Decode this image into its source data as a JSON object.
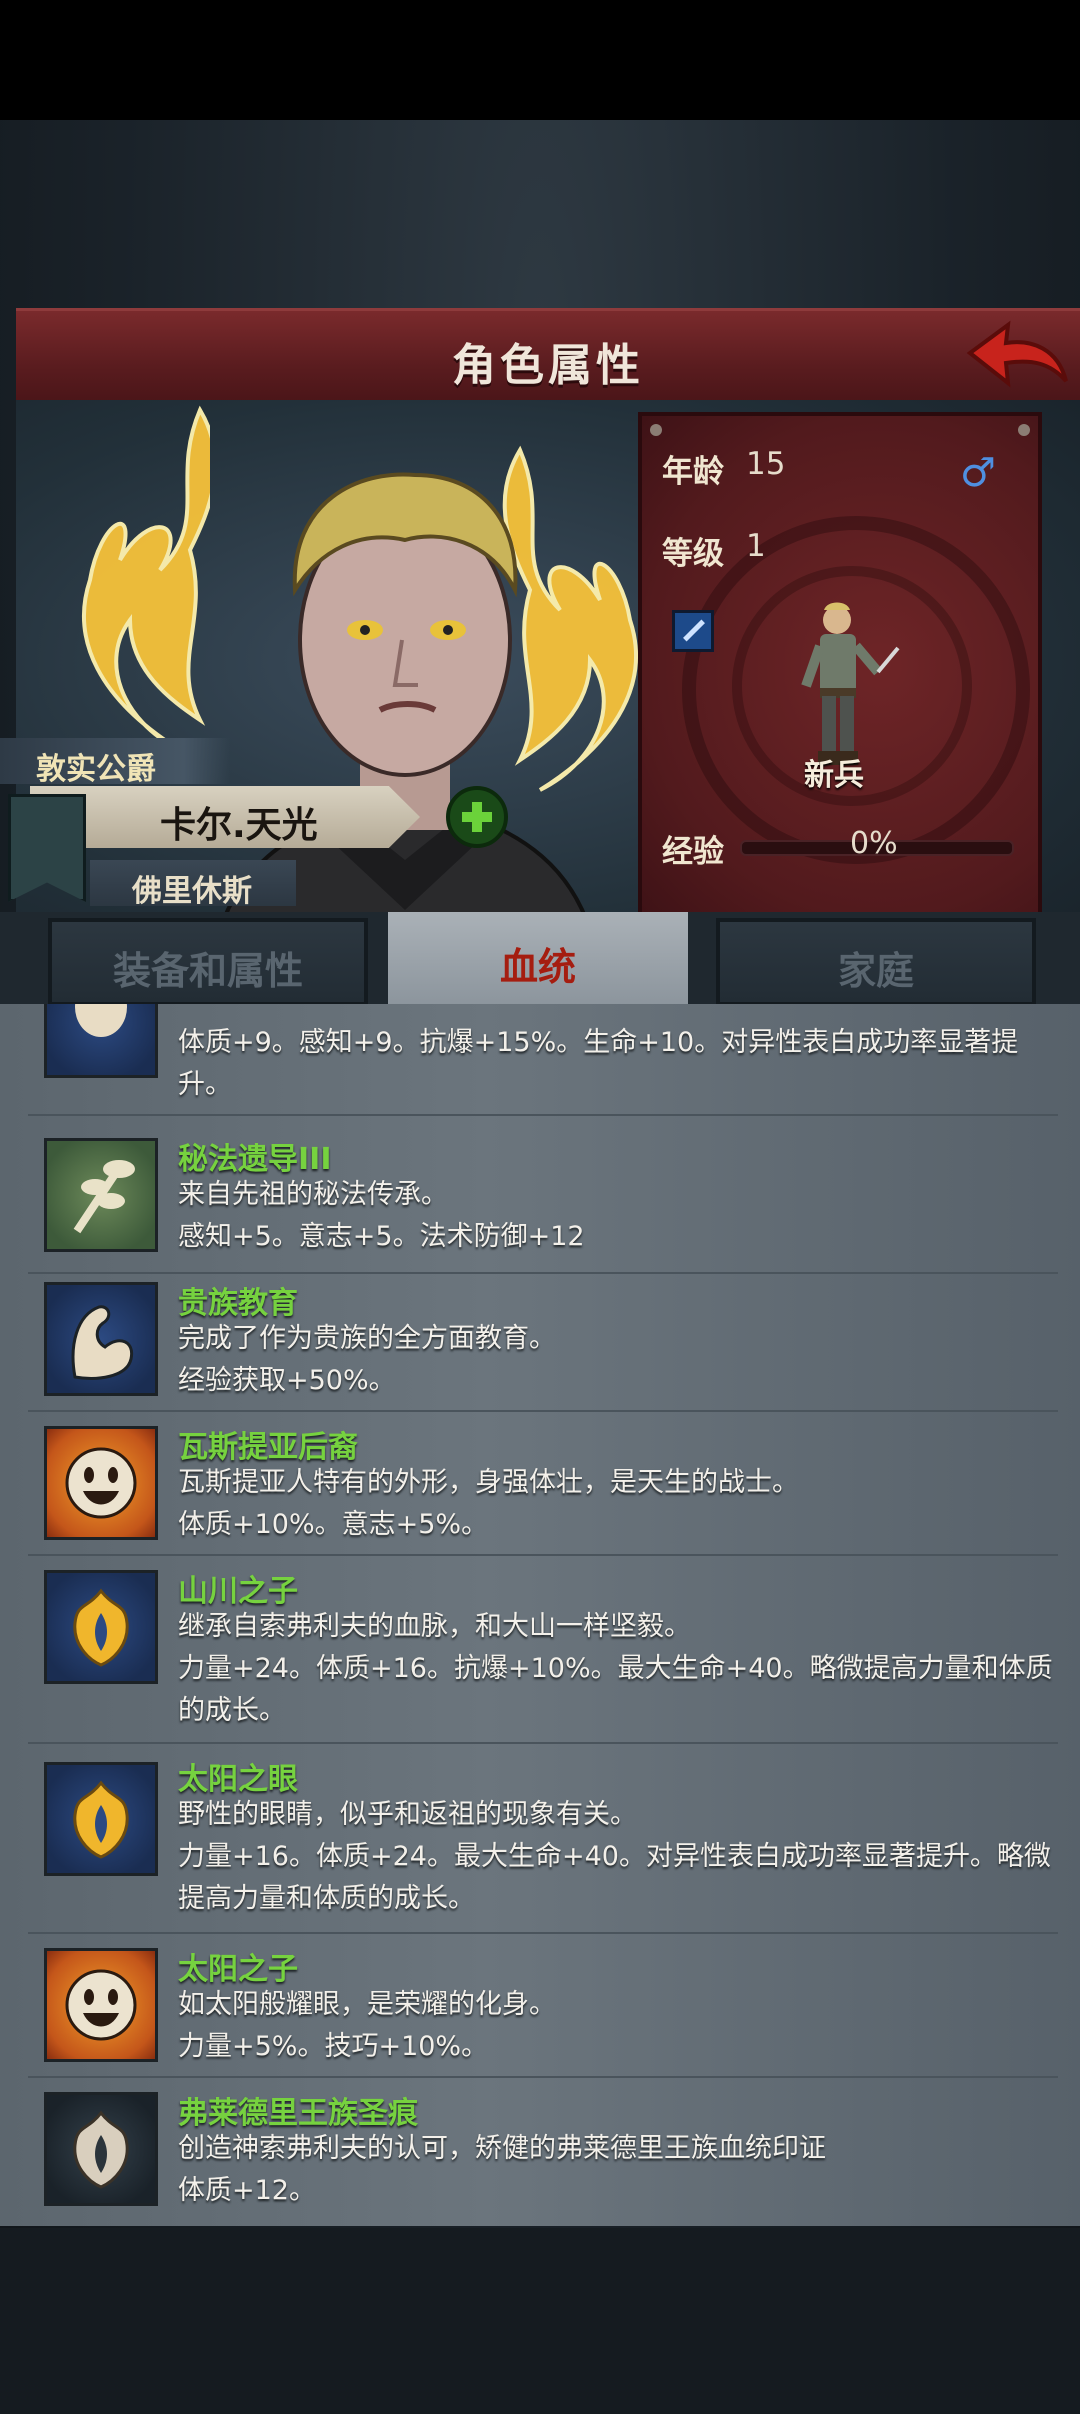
{
  "header": {
    "title": "角色属性"
  },
  "character": {
    "title": "敦实公爵",
    "name": "卡尔.天光",
    "homeland": "佛里休斯"
  },
  "stats": {
    "age_label": "年龄",
    "age": "15",
    "gender_symbol": "♂",
    "level_label": "等级",
    "level": "1",
    "class_name": "新兵",
    "exp_label": "经验",
    "exp_text": "0%",
    "exp_fraction": 0
  },
  "tabs": [
    {
      "label": "装备和属性",
      "active": false
    },
    {
      "label": "血统",
      "active": true
    },
    {
      "label": "家庭",
      "active": false
    }
  ],
  "traits": [
    {
      "name": "",
      "desc": "体质+9。感知+9。抗爆+15%。生命+10。对异性表白成功率显著提升。",
      "icon": "figure-icon"
    },
    {
      "name": "秘法遗导III",
      "desc": "来自先祖的秘法传承。\n感知+5。意志+5。法术防御+12",
      "icon": "branch-icon"
    },
    {
      "name": "贵族教育",
      "desc": "完成了作为贵族的全方面教育。\n经验获取+50%。",
      "icon": "flexed-arm-icon"
    },
    {
      "name": "瓦斯提亚后裔",
      "desc": "瓦斯提亚人特有的外形，身强体壮，是天生的战士。\n体质+10%。意志+5%。",
      "icon": "smiley-sun-icon"
    },
    {
      "name": "山川之子",
      "desc": "继承自索弗利夫的血脉，和大山一样坚毅。\n力量+24。体质+16。抗爆+10%。最大生命+40。略微提高力量和体质的成长。",
      "icon": "golden-flame-icon"
    },
    {
      "name": "太阳之眼",
      "desc": "野性的眼睛，似乎和返祖的现象有关。\n力量+16。体质+24。最大生命+40。对异性表白成功率显著提升。略微提高力量和体质的成长。",
      "icon": "golden-flame-icon"
    },
    {
      "name": "太阳之子",
      "desc": "如太阳般耀眼，是荣耀的化身。\n力量+5%。技巧+10%。",
      "icon": "smiley-sun-icon"
    },
    {
      "name": "弗莱德里王族圣痕",
      "desc": "创造神索弗利夫的认可，矫健的弗莱德里王族血统印证\n体质+12。",
      "icon": "pale-flame-icon"
    }
  ],
  "colors": {
    "trait_name": "#76d23f",
    "header": "#6b2426",
    "active_tab_text": "#a51d10"
  }
}
